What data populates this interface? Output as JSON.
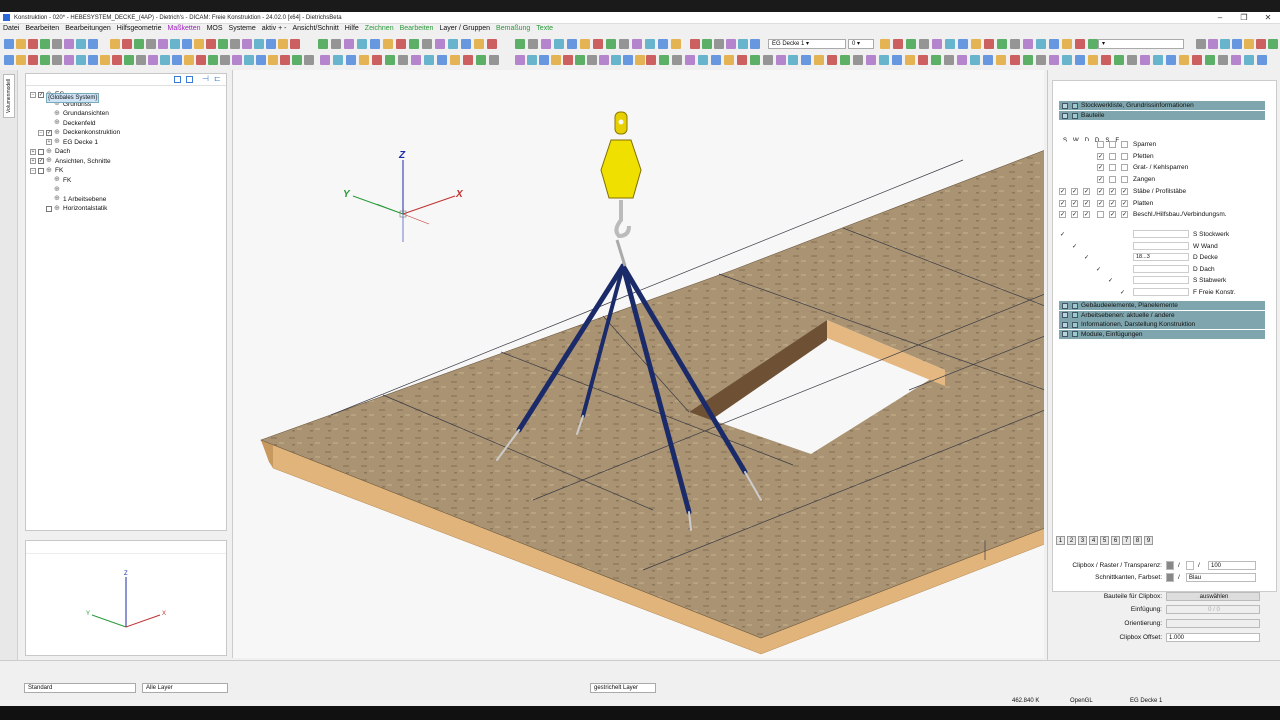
{
  "window": {
    "title": "Konstruktion - 020* - HEBESYSTEM_DECKE_(4AP) - Dietrich's - DICAM: Freie Konstruktion - 24.02.0 [x64] - DietrichsBeta"
  },
  "menu": [
    "Datei",
    "Bearbeiten",
    "Bearbeitungen",
    "Hilfsgeometrie",
    "Maßketten",
    "MOS",
    "Systeme",
    "aktiv + -",
    "Ansicht/Schnitt",
    "Hilfe",
    "Zeichnen",
    "Bearbeiten",
    "Layer / Gruppen",
    "Bemaßung",
    "Texte"
  ],
  "toolbar": {
    "storey_select": "EG Decke 1",
    "level_select": "0"
  },
  "left_tab": "Volumenmodell",
  "tree": [
    {
      "label": "EG",
      "indent": 0,
      "toggle": "−",
      "check": "✓"
    },
    {
      "label": "Grundriss",
      "indent": 2,
      "toggle": "",
      "check": ""
    },
    {
      "label": "Grundansichten",
      "indent": 2,
      "toggle": "",
      "check": ""
    },
    {
      "label": "Deckenfeld",
      "indent": 2,
      "toggle": "",
      "check": ""
    },
    {
      "label": "Deckenkonstruktion",
      "indent": 1,
      "toggle": "−",
      "check": "✓"
    },
    {
      "label": "EG Decke 1",
      "indent": 2,
      "toggle": "+",
      "check": "✓"
    },
    {
      "label": "Dach",
      "indent": 0,
      "toggle": "+",
      "check": ""
    },
    {
      "label": "Ansichten, Schnitte",
      "indent": 0,
      "toggle": "+",
      "check": "✓"
    },
    {
      "label": "FK",
      "indent": 0,
      "toggle": "−",
      "check": ""
    },
    {
      "label": "FK",
      "indent": 2,
      "toggle": "",
      "check": ""
    },
    {
      "label": "{Globales System}",
      "indent": 2,
      "toggle": "",
      "check": "",
      "selected": true
    },
    {
      "label": "1 Arbeitsebene",
      "indent": 2,
      "toggle": "",
      "check": ""
    },
    {
      "label": "Horizontalstatik",
      "indent": 1,
      "toggle": "",
      "check": ""
    }
  ],
  "axes": {
    "x": "X",
    "y": "Y",
    "z": "Z"
  },
  "right_panel": {
    "page_tabs": [
      "1",
      "2",
      "3",
      "4",
      "5",
      "6",
      "7",
      "8",
      "9"
    ],
    "sections_top": [
      "Stockwerkliste, Grundrissinformationen",
      "Bauteile"
    ],
    "filter_headers": [
      "S",
      "W",
      "D",
      "D",
      "S",
      "F"
    ],
    "layers": [
      {
        "label": "Sparren",
        "checks": [
          0,
          0,
          0,
          0,
          0,
          0
        ]
      },
      {
        "label": "Pfetten",
        "checks": [
          0,
          0,
          0,
          1,
          0,
          0
        ]
      },
      {
        "label": "Grat- / Kehlsparren",
        "checks": [
          0,
          0,
          0,
          1,
          0,
          0
        ]
      },
      {
        "label": "Zangen",
        "checks": [
          0,
          0,
          0,
          1,
          0,
          0
        ]
      },
      {
        "label": "Stäbe / Profilstäbe",
        "checks": [
          1,
          1,
          1,
          1,
          1,
          1
        ]
      },
      {
        "label": "Platten",
        "checks": [
          1,
          1,
          1,
          1,
          1,
          1
        ]
      },
      {
        "label": "Beschl./Hilfsbau./Verbindungsm.",
        "checks": [
          1,
          1,
          1,
          0,
          1,
          1
        ]
      }
    ],
    "storeys": [
      {
        "value": "",
        "label": "S Stockwerk"
      },
      {
        "value": "",
        "label": "W Wand"
      },
      {
        "value": "18...3",
        "label": "D Decke"
      },
      {
        "value": "",
        "label": "D Dach"
      },
      {
        "value": "",
        "label": "S Stabwerk"
      },
      {
        "value": "",
        "label": "F Freie Konstr."
      }
    ],
    "sections_bottom": [
      "Gebäudeelemente, Planelemente",
      "Arbeitsebenen: aktuelle / andere",
      "Informationen, Darstellung Konstruktion",
      "Module, Einfügungen"
    ],
    "props": {
      "clipbox_label": "Clipbox / Raster / Transparenz:",
      "clipbox_value": "100",
      "schnitt_label": "Schnittkanten, Farbset:",
      "schnitt_value": "Blau",
      "bauteile_label": "Bauteile für Clipbox:",
      "bauteile_btn": "auswählen",
      "einfuegung_label": "Einfügung:",
      "einfuegung_value": "0 / 0",
      "orientierung_label": "Orientierung:",
      "offset_label": "Clipbox Offset:",
      "offset_value": "1.000"
    }
  },
  "bottom": {
    "style_select": "Standard",
    "layer_select": "Alle Layer",
    "linetype_select": "gestrichelt Layer"
  },
  "status": {
    "coord": "462.840 K",
    "renderer": "OpenGL",
    "storey": "EG Decke 1"
  }
}
